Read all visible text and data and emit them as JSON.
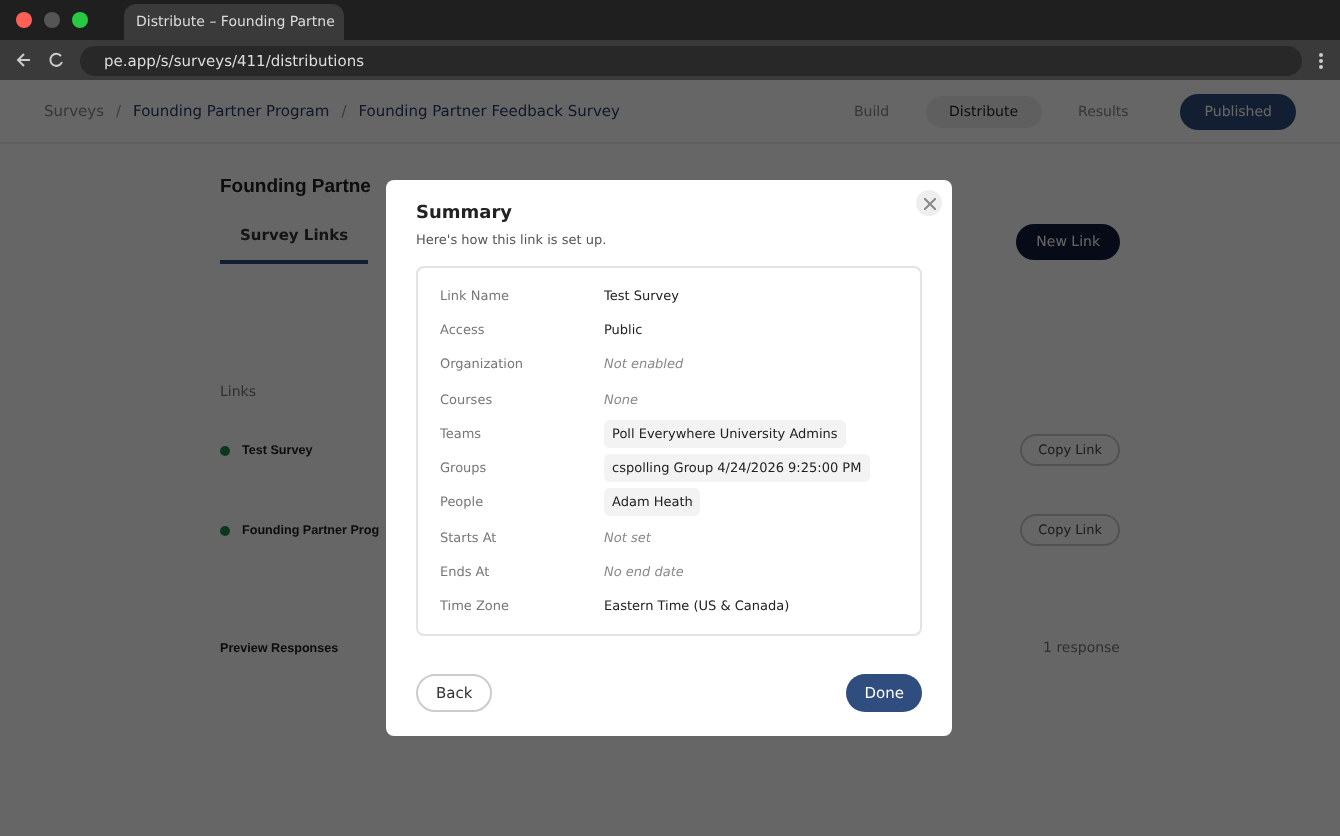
{
  "browser": {
    "tab_title": "Distribute – Founding Partne",
    "url": "pe.app/s/surveys/411/distributions"
  },
  "header": {
    "breadcrumb": [
      "Surveys",
      "Founding Partner Program",
      "Founding Partner Feedback Survey"
    ],
    "nav": [
      {
        "label": "Build",
        "selected": false
      },
      {
        "label": "Distribute",
        "selected": true
      },
      {
        "label": "Results",
        "selected": false
      }
    ],
    "separator": "/",
    "publish_button": "Published"
  },
  "page": {
    "title": "Founding Partne",
    "tabs": [
      {
        "label": "Survey Links",
        "selected": true
      }
    ],
    "new_link_button": "New Link",
    "links_label": "Links",
    "links": [
      {
        "name": "Test Survey",
        "active": true,
        "copy_button": "Copy Link"
      },
      {
        "name": "Founding Partner Prog",
        "active": true,
        "copy_button": "Copy Link"
      }
    ],
    "preview_title": "Preview Responses",
    "response_count": "1 response"
  },
  "modal": {
    "title": "Summary",
    "subtitle": "Here's how this link is set up.",
    "rows": [
      {
        "label": "Link Name",
        "value": "Test Survey",
        "kind": "text"
      },
      {
        "label": "Access",
        "value": "Public",
        "kind": "text"
      },
      {
        "label": "Organization",
        "value": "Not enabled",
        "kind": "empty"
      },
      {
        "label": "Courses",
        "value": "None",
        "kind": "empty"
      },
      {
        "label": "Teams",
        "value": "Poll Everywhere University Admins",
        "kind": "chip"
      },
      {
        "label": "Groups",
        "value": "cspolling Group 4/24/2026 9:25:00 PM",
        "kind": "chip"
      },
      {
        "label": "People",
        "value": "Adam Heath",
        "kind": "chip"
      },
      {
        "label": "Starts At",
        "value": "Not set",
        "kind": "empty"
      },
      {
        "label": "Ends At",
        "value": "No end date",
        "kind": "empty"
      },
      {
        "label": "Time Zone",
        "value": "Eastern Time (US & Canada)",
        "kind": "text"
      }
    ],
    "back_button": "Back",
    "done_button": "Done"
  }
}
